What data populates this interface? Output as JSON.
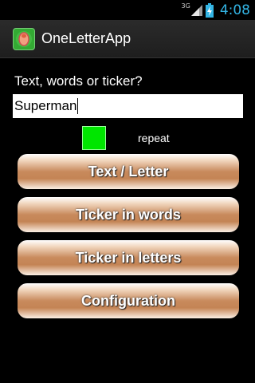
{
  "status_bar": {
    "network": "3G",
    "time": "4:08"
  },
  "app_bar": {
    "title": "OneLetterApp",
    "icon": "app-finger-icon"
  },
  "main": {
    "prompt_label": "Text, words or ticker?",
    "text_value": "Superman",
    "repeat_label": "repeat",
    "repeat_color": "#00e600",
    "buttons": [
      {
        "label": "Text / Letter"
      },
      {
        "label": "Ticker in words"
      },
      {
        "label": "Ticker in letters"
      },
      {
        "label": "Configuration"
      }
    ]
  }
}
